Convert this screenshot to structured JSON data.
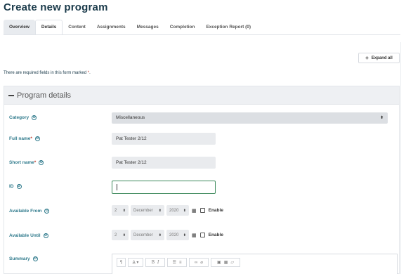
{
  "page": {
    "title": "Create new program",
    "expand_all": "Expand all",
    "required_note": "There are required fields in this form marked",
    "required_marker": "*",
    "info_glyph": "Θ"
  },
  "tabs": [
    {
      "label": "Overview"
    },
    {
      "label": "Details"
    },
    {
      "label": "Content"
    },
    {
      "label": "Assignments"
    },
    {
      "label": "Messages"
    },
    {
      "label": "Completion"
    },
    {
      "label": "Exception Report (0)"
    }
  ],
  "section": {
    "title": "Program details"
  },
  "fields": {
    "category": {
      "label": "Category",
      "value": "Miscellaneous"
    },
    "full_name": {
      "label": "Full name",
      "value": "Pat Tester 2/12"
    },
    "short_name": {
      "label": "Short name",
      "value": "Pat Tester 2/12"
    },
    "id": {
      "label": "ID",
      "value": ""
    },
    "available_from": {
      "label": "Available From",
      "day": "2",
      "month": "December",
      "year": "2020",
      "enable_label": "Enable"
    },
    "available_until": {
      "label": "Available Until",
      "day": "2",
      "month": "December",
      "year": "2020",
      "enable_label": "Enable"
    },
    "summary": {
      "label": "Summary"
    }
  },
  "editor_toolbar": {
    "para": "¶",
    "font": "A̲ ▾",
    "bold": "B",
    "italic": "I",
    "ul": "☰",
    "ol": "≡",
    "link": "∞",
    "unlink": "⌀",
    "image": "▣",
    "media": "▦",
    "file": "▱"
  },
  "colors": {
    "label_teal": "#2f7a8c",
    "required_red": "#c0392b",
    "focus_green": "#3d8a5c",
    "title_navy": "#1a3a4a"
  }
}
